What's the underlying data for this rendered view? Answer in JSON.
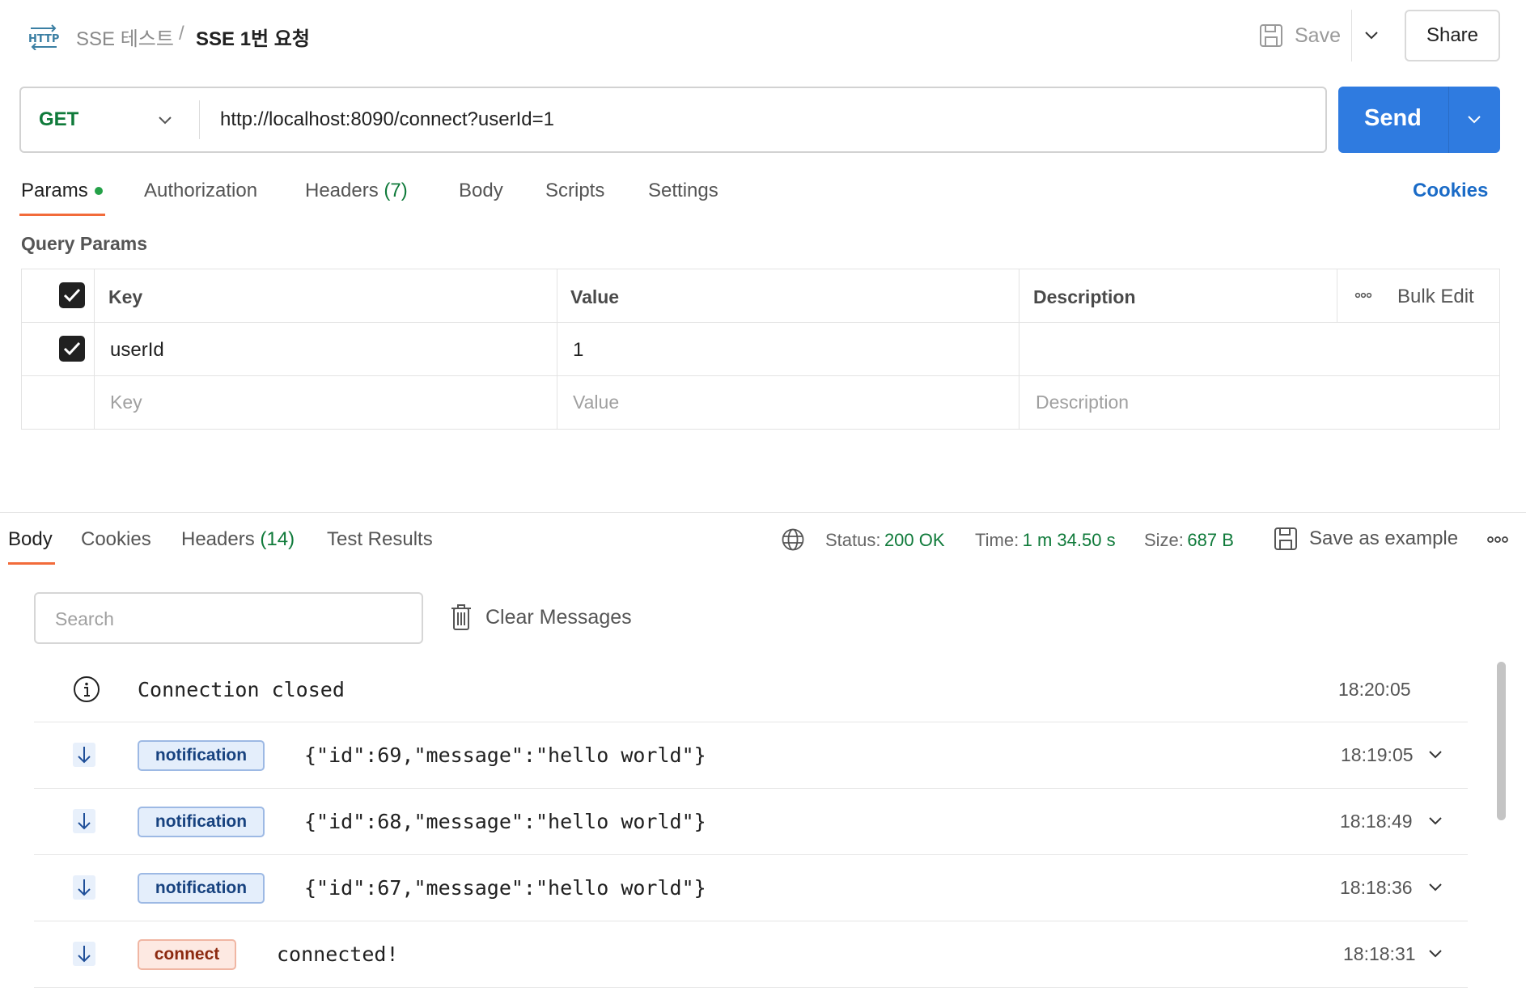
{
  "header": {
    "icon": "http-icon",
    "parent": "SSE 테스트",
    "separator": "/",
    "current": "SSE 1번 요청",
    "save_label": "Save",
    "share_label": "Share"
  },
  "request": {
    "method": "GET",
    "url": "http://localhost:8090/connect?userId=1",
    "send_label": "Send"
  },
  "tabs": [
    {
      "label": "Params",
      "active": true,
      "indicator": true
    },
    {
      "label": "Authorization"
    },
    {
      "label": "Headers",
      "count": "(7)"
    },
    {
      "label": "Body"
    },
    {
      "label": "Scripts"
    },
    {
      "label": "Settings"
    }
  ],
  "cookies_link": "Cookies",
  "query_params": {
    "title": "Query Params",
    "columns": {
      "key": "Key",
      "value": "Value",
      "description": "Description"
    },
    "bulk_edit": "Bulk Edit",
    "rows": [
      {
        "checked": true,
        "key": "userId",
        "value": "1",
        "description": ""
      }
    ],
    "placeholders": {
      "key": "Key",
      "value": "Value",
      "description": "Description"
    }
  },
  "response": {
    "tabs": [
      {
        "label": "Body",
        "active": true
      },
      {
        "label": "Cookies"
      },
      {
        "label": "Headers",
        "count": "(14)"
      },
      {
        "label": "Test Results"
      }
    ],
    "status_label": "Status:",
    "status_value": "200 OK",
    "time_label": "Time:",
    "time_value": "1 m 34.50 s",
    "size_label": "Size:",
    "size_value": "687 B",
    "save_example": "Save as example",
    "search_placeholder": "Search",
    "clear_messages": "Clear Messages",
    "messages": [
      {
        "kind": "info",
        "text": "Connection closed",
        "time": "18:20:05"
      },
      {
        "kind": "event",
        "event": "notification",
        "text": "{\"id\":69,\"message\":\"hello world\"}",
        "time": "18:19:05"
      },
      {
        "kind": "event",
        "event": "notification",
        "text": "{\"id\":68,\"message\":\"hello world\"}",
        "time": "18:18:49"
      },
      {
        "kind": "event",
        "event": "notification",
        "text": "{\"id\":67,\"message\":\"hello world\"}",
        "time": "18:18:36"
      },
      {
        "kind": "event",
        "event": "connect",
        "text": "connected!",
        "time": "18:18:31"
      }
    ]
  },
  "colors": {
    "accent": "#2f7be0",
    "method": "#0f7a3a",
    "tab_underline": "#f26b3a",
    "link": "#1a6bc7"
  }
}
